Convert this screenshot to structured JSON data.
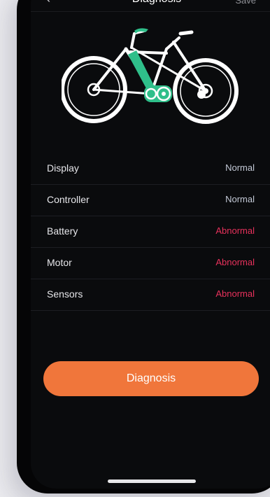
{
  "nav": {
    "back_icon": "chevron-left-icon",
    "title": "Diagnosis",
    "right_label": "Save"
  },
  "bike": {
    "image": "electric-bike-illustration",
    "accent_color": "#2fbf8a"
  },
  "diagnostics": [
    {
      "label": "Display",
      "status": "Normal",
      "color": "#c3c9d6"
    },
    {
      "label": "Controller",
      "status": "Normal",
      "color": "#c3c9d6"
    },
    {
      "label": "Battery",
      "status": "Abnormal",
      "color": "#e8315c"
    },
    {
      "label": "Motor",
      "status": "Abnormal",
      "color": "#e8315c"
    },
    {
      "label": "Sensors",
      "status": "Abnormal",
      "color": "#e8315c"
    }
  ],
  "button": {
    "label": "Diagnosis",
    "color": "#f0763b"
  }
}
